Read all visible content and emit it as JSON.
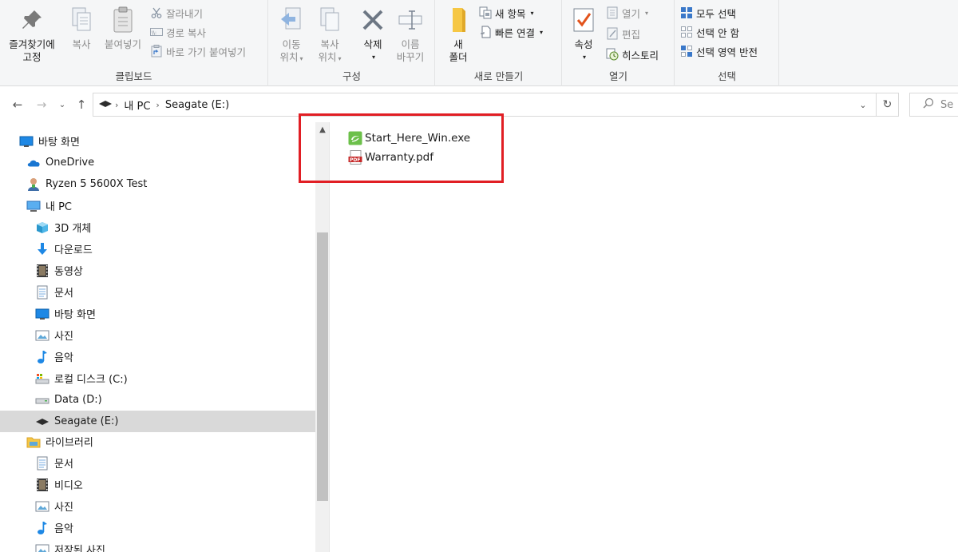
{
  "ribbon": {
    "clipboard": {
      "pin_line1": "즐겨찾기에",
      "pin_line2": "고정",
      "copy": "복사",
      "paste": "붙여넣기",
      "cut": "잘라내기",
      "copy_path": "경로 복사",
      "paste_shortcut": "바로 가기 붙여넣기",
      "label": "클립보드"
    },
    "organize": {
      "move_line1": "이동",
      "move_line2": "위치",
      "copyto_line1": "복사",
      "copyto_line2": "위치",
      "delete": "삭제",
      "rename_line1": "이름",
      "rename_line2": "바꾸기",
      "label": "구성"
    },
    "new": {
      "folder_line1": "새",
      "folder_line2": "폴더",
      "new_item": "새 항목",
      "easy_access": "빠른 연결",
      "label": "새로 만들기"
    },
    "open": {
      "properties": "속성",
      "open": "열기",
      "edit": "편집",
      "history": "히스토리",
      "label": "열기"
    },
    "select": {
      "select_all": "모두 선택",
      "select_none": "선택 안 함",
      "invert": "선택 영역 반전",
      "label": "선택"
    }
  },
  "address": {
    "crumb1": "내 PC",
    "crumb2": "Seagate (E:)",
    "search_placeholder": "Se"
  },
  "nav": {
    "items": [
      {
        "label": "바탕 화면",
        "icon": "desktop-icon"
      },
      {
        "label": "OneDrive",
        "icon": "onedrive-icon"
      },
      {
        "label": "Ryzen 5 5600X Test",
        "icon": "user-icon"
      },
      {
        "label": "내 PC",
        "icon": "pc-icon"
      },
      {
        "label": "3D 개체",
        "icon": "3d-objects-icon"
      },
      {
        "label": "다운로드",
        "icon": "download-icon"
      },
      {
        "label": "동영상",
        "icon": "video-icon"
      },
      {
        "label": "문서",
        "icon": "document-icon"
      },
      {
        "label": "바탕 화면",
        "icon": "desktop-icon"
      },
      {
        "label": "사진",
        "icon": "picture-icon"
      },
      {
        "label": "음악",
        "icon": "music-icon"
      },
      {
        "label": "로컬 디스크 (C:)",
        "icon": "local-disk-icon"
      },
      {
        "label": "Data (D:)",
        "icon": "drive-icon"
      },
      {
        "label": "Seagate (E:)",
        "icon": "seagate-drive-icon"
      },
      {
        "label": "라이브러리",
        "icon": "library-icon"
      },
      {
        "label": "문서",
        "icon": "document-icon"
      },
      {
        "label": "비디오",
        "icon": "video-icon"
      },
      {
        "label": "사진",
        "icon": "picture-icon"
      },
      {
        "label": "음악",
        "icon": "music-icon"
      },
      {
        "label": "저장된 사진",
        "icon": "picture-icon"
      }
    ]
  },
  "files": [
    {
      "name": "Start_Here_Win.exe",
      "icon": "seagate-exe-icon"
    },
    {
      "name": "Warranty.pdf",
      "icon": "pdf-icon"
    }
  ],
  "colors": {
    "highlight": "#e11e24",
    "selected_bg": "#d9d9d9",
    "accent": "#1e88e5"
  }
}
